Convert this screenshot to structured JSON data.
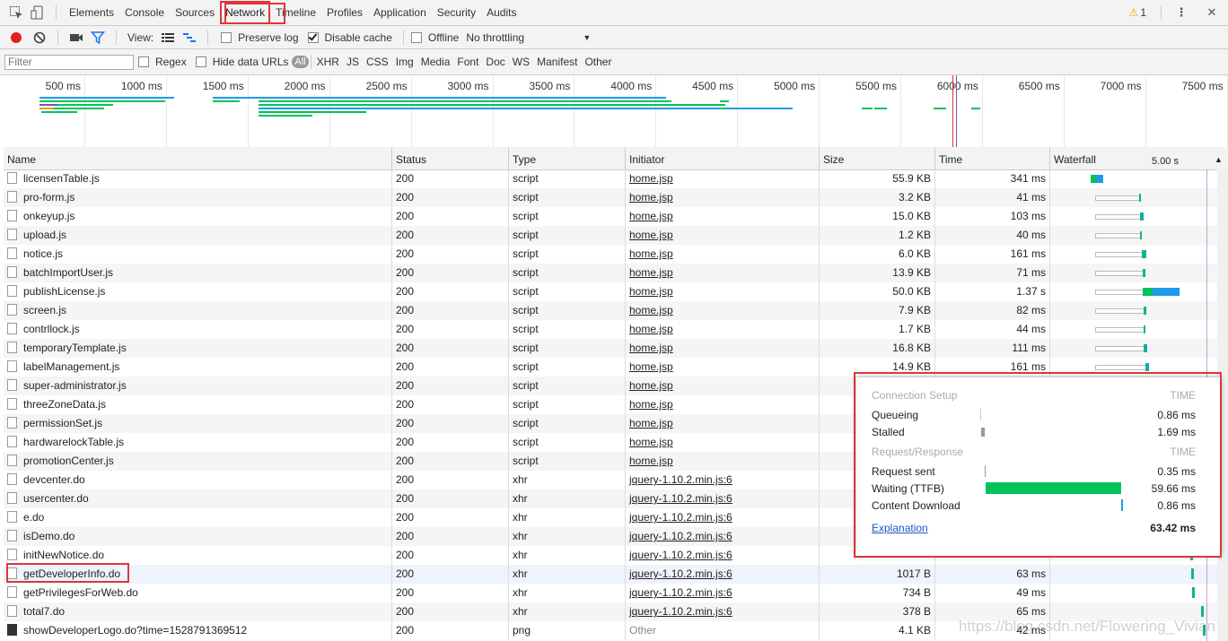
{
  "tabs": [
    "Elements",
    "Console",
    "Sources",
    "Network",
    "Timeline",
    "Profiles",
    "Application",
    "Security",
    "Audits"
  ],
  "selected_tab": "Network",
  "warning_count": "1",
  "toolbar": {
    "view_label": "View:",
    "preserve_log": "Preserve log",
    "disable_cache": "Disable cache",
    "offline": "Offline",
    "throttling": "No throttling"
  },
  "filterbar": {
    "placeholder": "Filter",
    "regex": "Regex",
    "hide_data_urls": "Hide data URLs",
    "types": [
      "All",
      "XHR",
      "JS",
      "CSS",
      "Img",
      "Media",
      "Font",
      "Doc",
      "WS",
      "Manifest",
      "Other"
    ]
  },
  "overview_ticks": [
    "500 ms",
    "1000 ms",
    "1500 ms",
    "2000 ms",
    "2500 ms",
    "3000 ms",
    "3500 ms",
    "4000 ms",
    "4500 ms",
    "5000 ms",
    "5500 ms",
    "6000 ms",
    "6500 ms",
    "7000 ms",
    "7500 ms"
  ],
  "columns": {
    "name": "Name",
    "status": "Status",
    "type": "Type",
    "initiator": "Initiator",
    "size": "Size",
    "time": "Time",
    "waterfall": "Waterfall",
    "waterfall_scale": "5.00 s"
  },
  "rows": [
    {
      "name": "licensenTable.js",
      "status": "200",
      "type": "script",
      "initiator": "home.jsp",
      "size": "55.9 KB",
      "time": "341 ms",
      "icon": "file"
    },
    {
      "name": "pro-form.js",
      "status": "200",
      "type": "script",
      "initiator": "home.jsp",
      "size": "3.2 KB",
      "time": "41 ms",
      "icon": "file"
    },
    {
      "name": "onkeyup.js",
      "status": "200",
      "type": "script",
      "initiator": "home.jsp",
      "size": "15.0 KB",
      "time": "103 ms",
      "icon": "file"
    },
    {
      "name": "upload.js",
      "status": "200",
      "type": "script",
      "initiator": "home.jsp",
      "size": "1.2 KB",
      "time": "40 ms",
      "icon": "file"
    },
    {
      "name": "notice.js",
      "status": "200",
      "type": "script",
      "initiator": "home.jsp",
      "size": "6.0 KB",
      "time": "161 ms",
      "icon": "file"
    },
    {
      "name": "batchImportUser.js",
      "status": "200",
      "type": "script",
      "initiator": "home.jsp",
      "size": "13.9 KB",
      "time": "71 ms",
      "icon": "file"
    },
    {
      "name": "publishLicense.js",
      "status": "200",
      "type": "script",
      "initiator": "home.jsp",
      "size": "50.0 KB",
      "time": "1.37 s",
      "icon": "file"
    },
    {
      "name": "screen.js",
      "status": "200",
      "type": "script",
      "initiator": "home.jsp",
      "size": "7.9 KB",
      "time": "82 ms",
      "icon": "file"
    },
    {
      "name": "contrllock.js",
      "status": "200",
      "type": "script",
      "initiator": "home.jsp",
      "size": "1.7 KB",
      "time": "44 ms",
      "icon": "file"
    },
    {
      "name": "temporaryTemplate.js",
      "status": "200",
      "type": "script",
      "initiator": "home.jsp",
      "size": "16.8 KB",
      "time": "111 ms",
      "icon": "file"
    },
    {
      "name": "labelManagement.js",
      "status": "200",
      "type": "script",
      "initiator": "home.jsp",
      "size": "14.9 KB",
      "time": "161 ms",
      "icon": "file"
    },
    {
      "name": "super-administrator.js",
      "status": "200",
      "type": "script",
      "initiator": "home.jsp",
      "size": "",
      "time": "",
      "icon": "file"
    },
    {
      "name": "threeZoneData.js",
      "status": "200",
      "type": "script",
      "initiator": "home.jsp",
      "size": "",
      "time": "",
      "icon": "file"
    },
    {
      "name": "permissionSet.js",
      "status": "200",
      "type": "script",
      "initiator": "home.jsp",
      "size": "",
      "time": "",
      "icon": "file"
    },
    {
      "name": "hardwarelockTable.js",
      "status": "200",
      "type": "script",
      "initiator": "home.jsp",
      "size": "",
      "time": "",
      "icon": "file"
    },
    {
      "name": "promotionCenter.js",
      "status": "200",
      "type": "script",
      "initiator": "home.jsp",
      "size": "",
      "time": "",
      "icon": "file"
    },
    {
      "name": "devcenter.do",
      "status": "200",
      "type": "xhr",
      "initiator": "jquery-1.10.2.min.js:6",
      "size": "",
      "time": "",
      "icon": "file"
    },
    {
      "name": "usercenter.do",
      "status": "200",
      "type": "xhr",
      "initiator": "jquery-1.10.2.min.js:6",
      "size": "",
      "time": "",
      "icon": "file"
    },
    {
      "name": "e.do",
      "status": "200",
      "type": "xhr",
      "initiator": "jquery-1.10.2.min.js:6",
      "size": "",
      "time": "",
      "icon": "file"
    },
    {
      "name": "isDemo.do",
      "status": "200",
      "type": "xhr",
      "initiator": "jquery-1.10.2.min.js:6",
      "size": "",
      "time": "",
      "icon": "file"
    },
    {
      "name": "initNewNotice.do",
      "status": "200",
      "type": "xhr",
      "initiator": "jquery-1.10.2.min.js:6",
      "size": "",
      "time": "",
      "icon": "file"
    },
    {
      "name": "getDeveloperInfo.do",
      "status": "200",
      "type": "xhr",
      "initiator": "jquery-1.10.2.min.js:6",
      "size": "1017 B",
      "time": "63 ms",
      "icon": "file"
    },
    {
      "name": "getPrivilegesForWeb.do",
      "status": "200",
      "type": "xhr",
      "initiator": "jquery-1.10.2.min.js:6",
      "size": "734 B",
      "time": "49 ms",
      "icon": "file"
    },
    {
      "name": "total7.do",
      "status": "200",
      "type": "xhr",
      "initiator": "jquery-1.10.2.min.js:6",
      "size": "378 B",
      "time": "65 ms",
      "icon": "file"
    },
    {
      "name": "showDeveloperLogo.do?time=1528791369512",
      "status": "200",
      "type": "png",
      "initiator": "Other",
      "size": "4.1 KB",
      "time": "42 ms",
      "icon": "img"
    }
  ],
  "timing_popup": {
    "connection_setup": "Connection Setup",
    "time_header": "TIME",
    "queueing_label": "Queueing",
    "queueing_value": "0.86 ms",
    "stalled_label": "Stalled",
    "stalled_value": "1.69 ms",
    "request_response": "Request/Response",
    "request_sent_label": "Request sent",
    "request_sent_value": "0.35 ms",
    "waiting_label": "Waiting (TTFB)",
    "waiting_value": "59.66 ms",
    "download_label": "Content Download",
    "download_value": "0.86 ms",
    "explanation": "Explanation",
    "total": "63.42 ms"
  },
  "watermark": "https://blog.csdn.net/Flowering_Vivian",
  "colors": {
    "waiting": "#00c35a",
    "download": "#1e9be8",
    "highlight": "#e0363a",
    "record": "#e02020"
  }
}
